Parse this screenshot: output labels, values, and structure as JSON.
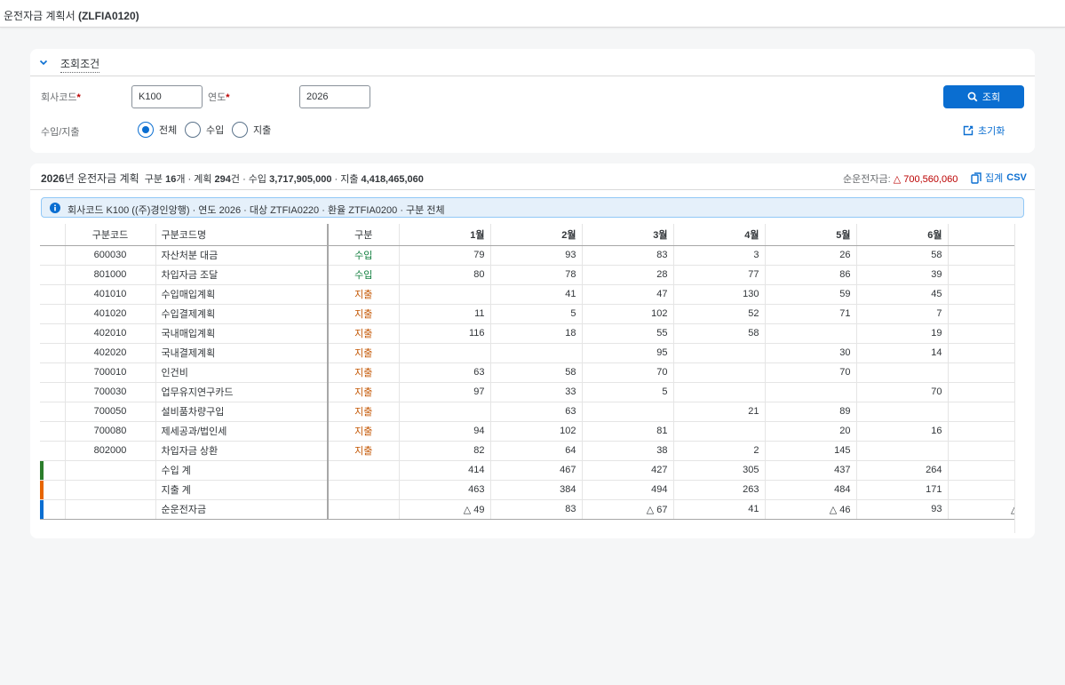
{
  "app": {
    "title_prefix": "운전자금 계획서 ",
    "title_code": "(ZLFIA0120)"
  },
  "filter": {
    "header_label": "조회조건",
    "company_label": "회사코드",
    "company_value": "K100",
    "year_label": "연도",
    "year_value": "2026",
    "required_mark": "*",
    "type_label": "수입/지출",
    "radios": [
      "전체",
      "수입",
      "지출"
    ],
    "radio_selected": 0,
    "search_button": "조회",
    "reset_button": "초기화"
  },
  "result": {
    "title_year": "2026",
    "title_suffix": "년 운전자금 계획",
    "summary_1": "구분 ",
    "summary_count": "16",
    "summary_2": "개 · 계획 ",
    "summary_plan": "294",
    "summary_3": "건 · 수입 ",
    "summary_income": "3,717,905,000",
    "summary_4": " · 지출 ",
    "summary_expense": "4,418,465,060",
    "net_label": "순운전자금: ",
    "net_value": "△ 700,560,060",
    "csv_label_1": "집계 ",
    "csv_label_2": "CSV",
    "info_text": "회사코드 K100 ((주)경인앙행) · 연도 2026 · 대상 ZTFIA0220 · 환율 ZTFIA0200 · 구분 전체"
  },
  "table": {
    "columns": [
      "구분코드",
      "구분코드명",
      "구분",
      "1월",
      "2월",
      "3월",
      "4월",
      "5월",
      "6월",
      ""
    ],
    "rows": [
      {
        "code": "600030",
        "name": "자산처분 대금",
        "type": "수입",
        "kind": "in",
        "m": [
          "79",
          "93",
          "83",
          "3",
          "26",
          "58",
          ""
        ]
      },
      {
        "code": "801000",
        "name": "차입자금 조달",
        "type": "수입",
        "kind": "in",
        "m": [
          "80",
          "78",
          "28",
          "77",
          "86",
          "39",
          ""
        ]
      },
      {
        "code": "401010",
        "name": "수입매입계획",
        "type": "지출",
        "kind": "out",
        "m": [
          "",
          "41",
          "47",
          "130",
          "59",
          "45",
          ""
        ]
      },
      {
        "code": "401020",
        "name": "수입결제계획",
        "type": "지출",
        "kind": "out",
        "m": [
          "11",
          "5",
          "102",
          "52",
          "71",
          "7",
          ""
        ]
      },
      {
        "code": "402010",
        "name": "국내매입계획",
        "type": "지출",
        "kind": "out",
        "m": [
          "116",
          "18",
          "55",
          "58",
          "",
          "19",
          ""
        ]
      },
      {
        "code": "402020",
        "name": "국내결제계획",
        "type": "지출",
        "kind": "out",
        "m": [
          "",
          "",
          "95",
          "",
          "30",
          "14",
          ""
        ]
      },
      {
        "code": "700010",
        "name": "인건비",
        "type": "지출",
        "kind": "out",
        "m": [
          "63",
          "58",
          "70",
          "",
          "70",
          "",
          ""
        ]
      },
      {
        "code": "700030",
        "name": "업무유지연구카드",
        "type": "지출",
        "kind": "out",
        "m": [
          "97",
          "33",
          "5",
          "",
          "",
          "70",
          ""
        ]
      },
      {
        "code": "700050",
        "name": "설비품차량구입",
        "type": "지출",
        "kind": "out",
        "m": [
          "",
          "63",
          "",
          "21",
          "89",
          "",
          ""
        ]
      },
      {
        "code": "700080",
        "name": "제세공과/법인세",
        "type": "지출",
        "kind": "out",
        "m": [
          "94",
          "102",
          "81",
          "",
          "20",
          "16",
          ""
        ]
      },
      {
        "code": "802000",
        "name": "차입자금 상환",
        "type": "지출",
        "kind": "out",
        "m": [
          "82",
          "64",
          "38",
          "2",
          "145",
          "",
          ""
        ]
      }
    ],
    "summary": [
      {
        "name": "수입 계",
        "color": "#2b7d2b",
        "m": [
          "414",
          "467",
          "427",
          "305",
          "437",
          "264",
          ""
        ]
      },
      {
        "name": "지출 계",
        "color": "#e76500",
        "m": [
          "463",
          "384",
          "494",
          "263",
          "484",
          "171",
          ""
        ]
      },
      {
        "name": "순운전자금",
        "color": "#0a6ed1",
        "m": [
          "△ 49",
          "83",
          "△ 67",
          "41",
          "△ 46",
          "93",
          "△"
        ]
      }
    ]
  },
  "colors": {
    "accent": "#0a6ed1",
    "income": "#107e3e",
    "expense": "#c35500",
    "negative": "#bb0000"
  }
}
